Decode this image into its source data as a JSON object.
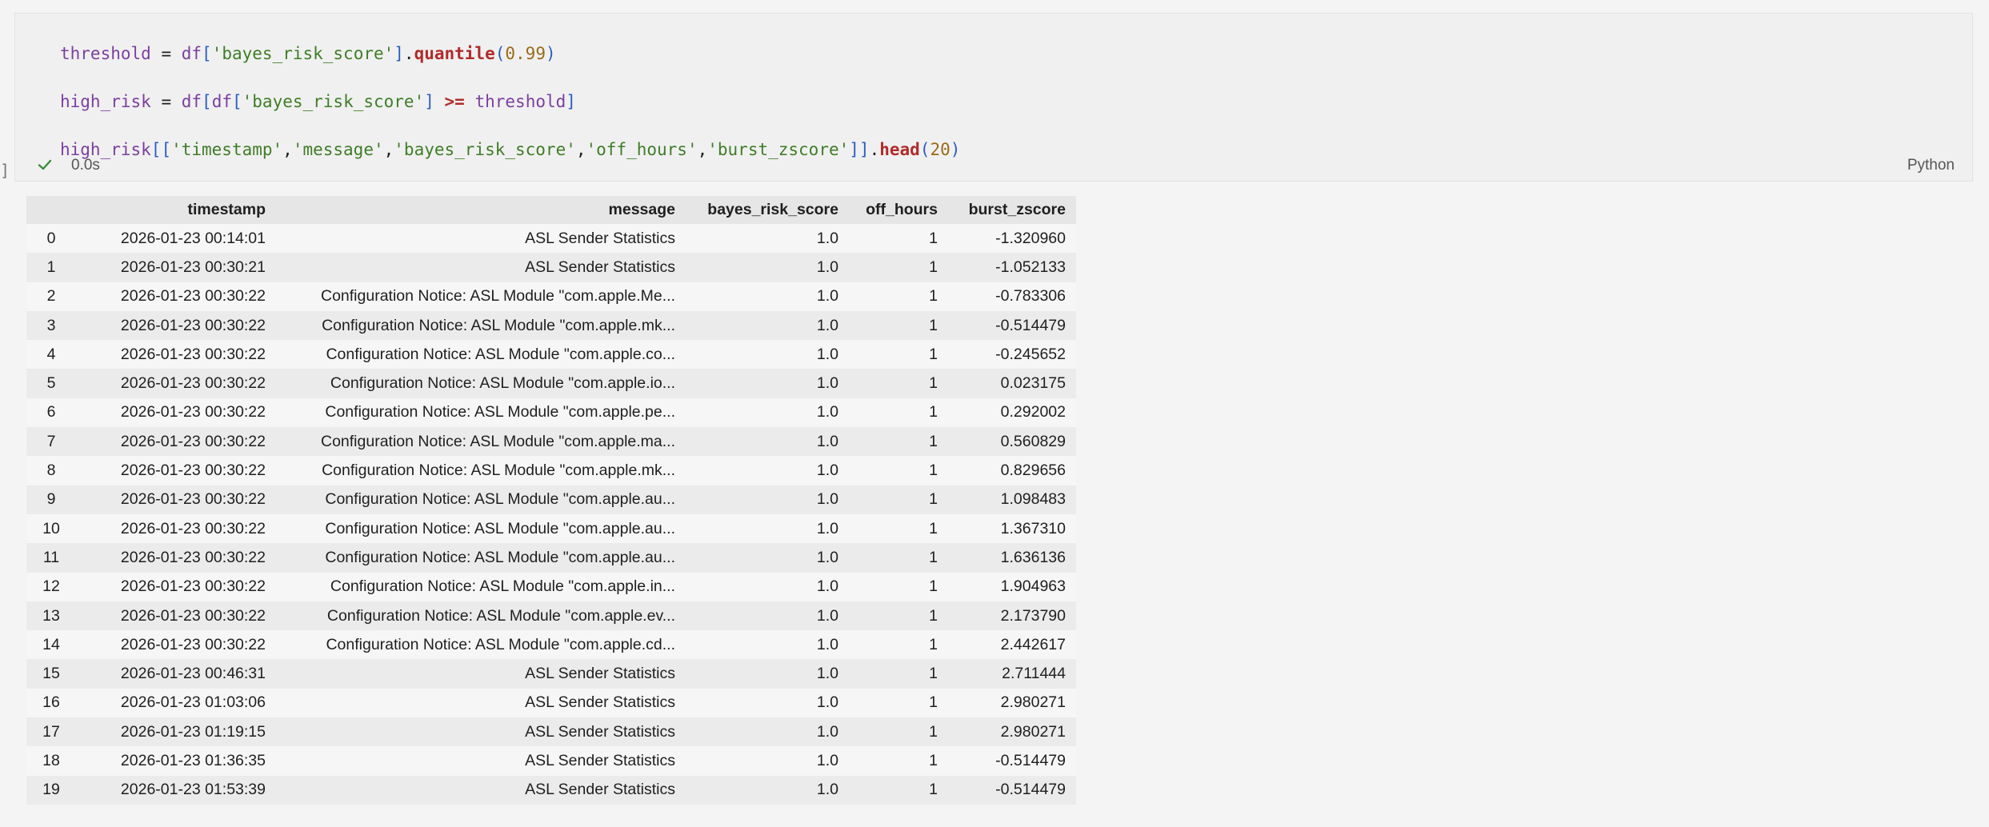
{
  "cell": {
    "code_lines": [
      [
        {
          "t": "threshold",
          "c": "var"
        },
        {
          "t": " = ",
          "c": "pn"
        },
        {
          "t": "df",
          "c": "var"
        },
        {
          "t": "[",
          "c": "br"
        },
        {
          "t": "'bayes_risk_score'",
          "c": "str"
        },
        {
          "t": "]",
          "c": "br"
        },
        {
          "t": ".",
          "c": "pn"
        },
        {
          "t": "quantile",
          "c": "fn"
        },
        {
          "t": "(",
          "c": "br"
        },
        {
          "t": "0.99",
          "c": "num"
        },
        {
          "t": ")",
          "c": "br"
        }
      ],
      [
        {
          "t": "high_risk",
          "c": "var"
        },
        {
          "t": " = ",
          "c": "pn"
        },
        {
          "t": "df",
          "c": "var"
        },
        {
          "t": "[",
          "c": "br"
        },
        {
          "t": "df",
          "c": "var"
        },
        {
          "t": "[",
          "c": "br"
        },
        {
          "t": "'bayes_risk_score'",
          "c": "str"
        },
        {
          "t": "]",
          "c": "br"
        },
        {
          "t": " ",
          "c": "pn"
        },
        {
          "t": ">=",
          "c": "op"
        },
        {
          "t": " ",
          "c": "pn"
        },
        {
          "t": "threshold",
          "c": "var"
        },
        {
          "t": "]",
          "c": "br"
        }
      ],
      [
        {
          "t": "high_risk",
          "c": "var"
        },
        {
          "t": "[[",
          "c": "br"
        },
        {
          "t": "'timestamp'",
          "c": "str"
        },
        {
          "t": ",",
          "c": "pn"
        },
        {
          "t": "'message'",
          "c": "str"
        },
        {
          "t": ",",
          "c": "pn"
        },
        {
          "t": "'bayes_risk_score'",
          "c": "str"
        },
        {
          "t": ",",
          "c": "pn"
        },
        {
          "t": "'off_hours'",
          "c": "str"
        },
        {
          "t": ",",
          "c": "pn"
        },
        {
          "t": "'burst_zscore'",
          "c": "str"
        },
        {
          "t": "]]",
          "c": "br"
        },
        {
          "t": ".",
          "c": "pn"
        },
        {
          "t": "head",
          "c": "fn"
        },
        {
          "t": "(",
          "c": "br"
        },
        {
          "t": "20",
          "c": "num"
        },
        {
          "t": ")",
          "c": "br"
        }
      ]
    ],
    "status_icon": "check-icon",
    "elapsed": "0.0s",
    "language": "Python",
    "left_marker": "]"
  },
  "table": {
    "columns": [
      "",
      "timestamp",
      "message",
      "bayes_risk_score",
      "off_hours",
      "burst_zscore"
    ],
    "rows": [
      [
        "0",
        "2026-01-23 00:14:01",
        "ASL Sender Statistics",
        "1.0",
        "1",
        "-1.320960"
      ],
      [
        "1",
        "2026-01-23 00:30:21",
        "ASL Sender Statistics",
        "1.0",
        "1",
        "-1.052133"
      ],
      [
        "2",
        "2026-01-23 00:30:22",
        "Configuration Notice: ASL Module \"com.apple.Me...",
        "1.0",
        "1",
        "-0.783306"
      ],
      [
        "3",
        "2026-01-23 00:30:22",
        "Configuration Notice: ASL Module \"com.apple.mk...",
        "1.0",
        "1",
        "-0.514479"
      ],
      [
        "4",
        "2026-01-23 00:30:22",
        "Configuration Notice: ASL Module \"com.apple.co...",
        "1.0",
        "1",
        "-0.245652"
      ],
      [
        "5",
        "2026-01-23 00:30:22",
        "Configuration Notice: ASL Module \"com.apple.io...",
        "1.0",
        "1",
        "0.023175"
      ],
      [
        "6",
        "2026-01-23 00:30:22",
        "Configuration Notice: ASL Module \"com.apple.pe...",
        "1.0",
        "1",
        "0.292002"
      ],
      [
        "7",
        "2026-01-23 00:30:22",
        "Configuration Notice: ASL Module \"com.apple.ma...",
        "1.0",
        "1",
        "0.560829"
      ],
      [
        "8",
        "2026-01-23 00:30:22",
        "Configuration Notice: ASL Module \"com.apple.mk...",
        "1.0",
        "1",
        "0.829656"
      ],
      [
        "9",
        "2026-01-23 00:30:22",
        "Configuration Notice: ASL Module \"com.apple.au...",
        "1.0",
        "1",
        "1.098483"
      ],
      [
        "10",
        "2026-01-23 00:30:22",
        "Configuration Notice: ASL Module \"com.apple.au...",
        "1.0",
        "1",
        "1.367310"
      ],
      [
        "11",
        "2026-01-23 00:30:22",
        "Configuration Notice: ASL Module \"com.apple.au...",
        "1.0",
        "1",
        "1.636136"
      ],
      [
        "12",
        "2026-01-23 00:30:22",
        "Configuration Notice: ASL Module \"com.apple.in...",
        "1.0",
        "1",
        "1.904963"
      ],
      [
        "13",
        "2026-01-23 00:30:22",
        "Configuration Notice: ASL Module \"com.apple.ev...",
        "1.0",
        "1",
        "2.173790"
      ],
      [
        "14",
        "2026-01-23 00:30:22",
        "Configuration Notice: ASL Module \"com.apple.cd...",
        "1.0",
        "1",
        "2.442617"
      ],
      [
        "15",
        "2026-01-23 00:46:31",
        "ASL Sender Statistics",
        "1.0",
        "1",
        "2.711444"
      ],
      [
        "16",
        "2026-01-23 01:03:06",
        "ASL Sender Statistics",
        "1.0",
        "1",
        "2.980271"
      ],
      [
        "17",
        "2026-01-23 01:19:15",
        "ASL Sender Statistics",
        "1.0",
        "1",
        "2.980271"
      ],
      [
        "18",
        "2026-01-23 01:36:35",
        "ASL Sender Statistics",
        "1.0",
        "1",
        "-0.514479"
      ],
      [
        "19",
        "2026-01-23 01:53:39",
        "ASL Sender Statistics",
        "1.0",
        "1",
        "-0.514479"
      ]
    ]
  }
}
